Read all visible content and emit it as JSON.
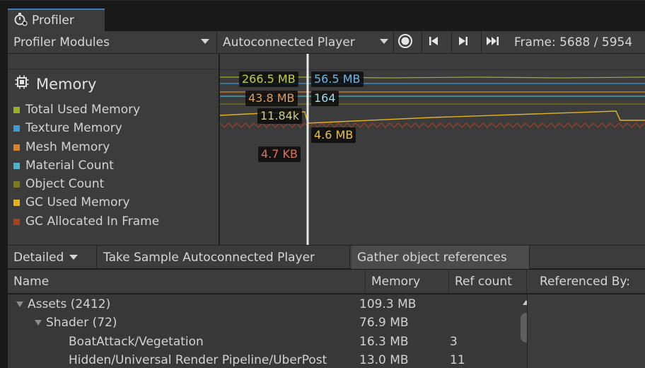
{
  "window": {
    "tab_title": "Profiler",
    "tab_icon": "stopwatch-icon"
  },
  "toolbar": {
    "modules_label": "Profiler Modules",
    "player_label": "Autoconnected Player",
    "frame_text": "Frame: 5688 / 5954",
    "icons": [
      "record-icon",
      "step-back-icon",
      "step-forward-icon",
      "skip-to-end-icon"
    ]
  },
  "legend": {
    "title": "Memory",
    "title_icon": "chip-icon",
    "items": [
      {
        "label": "Total Used Memory",
        "color": "#9ab01f"
      },
      {
        "label": "Texture Memory",
        "color": "#3b9bd6"
      },
      {
        "label": "Mesh Memory",
        "color": "#d9822b"
      },
      {
        "label": "Material Count",
        "color": "#4ab5c8"
      },
      {
        "label": "Object Count",
        "color": "#7d7a1e"
      },
      {
        "label": "GC Used Memory",
        "color": "#e0b21c"
      },
      {
        "label": "GC Allocated In Frame",
        "color": "#a8401f"
      }
    ]
  },
  "chart": {
    "labels": [
      {
        "text": "266.5 MB",
        "color": "#bfcf4a"
      },
      {
        "text": "56.5 MB",
        "color": "#6fb7e6"
      },
      {
        "text": "43.8 MB",
        "color": "#e39a55"
      },
      {
        "text": "164",
        "color": "#9fdde6"
      },
      {
        "text": "11.84k",
        "color": "#cfcd8a"
      },
      {
        "text": "4.6 MB",
        "color": "#e8c34a"
      },
      {
        "text": "4.7 KB",
        "color": "#e0705a"
      }
    ]
  },
  "bottombar": {
    "detailed_label": "Detailed",
    "take_sample_label": "Take Sample Autoconnected Player",
    "gather_label": "Gather object references"
  },
  "table": {
    "columns": [
      "Name",
      "Memory",
      "Ref count",
      "Referenced By:"
    ],
    "rows": [
      {
        "name": "Assets (2412)",
        "memory": "109.3 MB",
        "ref": ""
      },
      {
        "name": "Shader (72)",
        "memory": "76.9 MB",
        "ref": ""
      },
      {
        "name": "BoatAttack/Vegetation",
        "memory": "16.3 MB",
        "ref": "3"
      },
      {
        "name": "Hidden/Universal Render Pipeline/UberPost",
        "memory": "13.0 MB",
        "ref": "11"
      }
    ]
  }
}
